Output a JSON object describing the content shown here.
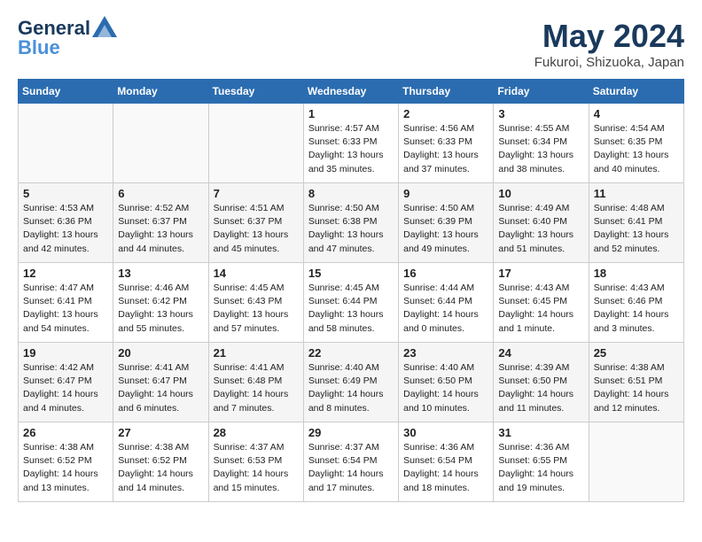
{
  "header": {
    "logo_line1": "General",
    "logo_line2": "Blue",
    "month_year": "May 2024",
    "location": "Fukuroi, Shizuoka, Japan"
  },
  "weekdays": [
    "Sunday",
    "Monday",
    "Tuesday",
    "Wednesday",
    "Thursday",
    "Friday",
    "Saturday"
  ],
  "weeks": [
    [
      {
        "day": "",
        "info": ""
      },
      {
        "day": "",
        "info": ""
      },
      {
        "day": "",
        "info": ""
      },
      {
        "day": "1",
        "info": "Sunrise: 4:57 AM\nSunset: 6:33 PM\nDaylight: 13 hours\nand 35 minutes."
      },
      {
        "day": "2",
        "info": "Sunrise: 4:56 AM\nSunset: 6:33 PM\nDaylight: 13 hours\nand 37 minutes."
      },
      {
        "day": "3",
        "info": "Sunrise: 4:55 AM\nSunset: 6:34 PM\nDaylight: 13 hours\nand 38 minutes."
      },
      {
        "day": "4",
        "info": "Sunrise: 4:54 AM\nSunset: 6:35 PM\nDaylight: 13 hours\nand 40 minutes."
      }
    ],
    [
      {
        "day": "5",
        "info": "Sunrise: 4:53 AM\nSunset: 6:36 PM\nDaylight: 13 hours\nand 42 minutes."
      },
      {
        "day": "6",
        "info": "Sunrise: 4:52 AM\nSunset: 6:37 PM\nDaylight: 13 hours\nand 44 minutes."
      },
      {
        "day": "7",
        "info": "Sunrise: 4:51 AM\nSunset: 6:37 PM\nDaylight: 13 hours\nand 45 minutes."
      },
      {
        "day": "8",
        "info": "Sunrise: 4:50 AM\nSunset: 6:38 PM\nDaylight: 13 hours\nand 47 minutes."
      },
      {
        "day": "9",
        "info": "Sunrise: 4:50 AM\nSunset: 6:39 PM\nDaylight: 13 hours\nand 49 minutes."
      },
      {
        "day": "10",
        "info": "Sunrise: 4:49 AM\nSunset: 6:40 PM\nDaylight: 13 hours\nand 51 minutes."
      },
      {
        "day": "11",
        "info": "Sunrise: 4:48 AM\nSunset: 6:41 PM\nDaylight: 13 hours\nand 52 minutes."
      }
    ],
    [
      {
        "day": "12",
        "info": "Sunrise: 4:47 AM\nSunset: 6:41 PM\nDaylight: 13 hours\nand 54 minutes."
      },
      {
        "day": "13",
        "info": "Sunrise: 4:46 AM\nSunset: 6:42 PM\nDaylight: 13 hours\nand 55 minutes."
      },
      {
        "day": "14",
        "info": "Sunrise: 4:45 AM\nSunset: 6:43 PM\nDaylight: 13 hours\nand 57 minutes."
      },
      {
        "day": "15",
        "info": "Sunrise: 4:45 AM\nSunset: 6:44 PM\nDaylight: 13 hours\nand 58 minutes."
      },
      {
        "day": "16",
        "info": "Sunrise: 4:44 AM\nSunset: 6:44 PM\nDaylight: 14 hours\nand 0 minutes."
      },
      {
        "day": "17",
        "info": "Sunrise: 4:43 AM\nSunset: 6:45 PM\nDaylight: 14 hours\nand 1 minute."
      },
      {
        "day": "18",
        "info": "Sunrise: 4:43 AM\nSunset: 6:46 PM\nDaylight: 14 hours\nand 3 minutes."
      }
    ],
    [
      {
        "day": "19",
        "info": "Sunrise: 4:42 AM\nSunset: 6:47 PM\nDaylight: 14 hours\nand 4 minutes."
      },
      {
        "day": "20",
        "info": "Sunrise: 4:41 AM\nSunset: 6:47 PM\nDaylight: 14 hours\nand 6 minutes."
      },
      {
        "day": "21",
        "info": "Sunrise: 4:41 AM\nSunset: 6:48 PM\nDaylight: 14 hours\nand 7 minutes."
      },
      {
        "day": "22",
        "info": "Sunrise: 4:40 AM\nSunset: 6:49 PM\nDaylight: 14 hours\nand 8 minutes."
      },
      {
        "day": "23",
        "info": "Sunrise: 4:40 AM\nSunset: 6:50 PM\nDaylight: 14 hours\nand 10 minutes."
      },
      {
        "day": "24",
        "info": "Sunrise: 4:39 AM\nSunset: 6:50 PM\nDaylight: 14 hours\nand 11 minutes."
      },
      {
        "day": "25",
        "info": "Sunrise: 4:38 AM\nSunset: 6:51 PM\nDaylight: 14 hours\nand 12 minutes."
      }
    ],
    [
      {
        "day": "26",
        "info": "Sunrise: 4:38 AM\nSunset: 6:52 PM\nDaylight: 14 hours\nand 13 minutes."
      },
      {
        "day": "27",
        "info": "Sunrise: 4:38 AM\nSunset: 6:52 PM\nDaylight: 14 hours\nand 14 minutes."
      },
      {
        "day": "28",
        "info": "Sunrise: 4:37 AM\nSunset: 6:53 PM\nDaylight: 14 hours\nand 15 minutes."
      },
      {
        "day": "29",
        "info": "Sunrise: 4:37 AM\nSunset: 6:54 PM\nDaylight: 14 hours\nand 17 minutes."
      },
      {
        "day": "30",
        "info": "Sunrise: 4:36 AM\nSunset: 6:54 PM\nDaylight: 14 hours\nand 18 minutes."
      },
      {
        "day": "31",
        "info": "Sunrise: 4:36 AM\nSunset: 6:55 PM\nDaylight: 14 hours\nand 19 minutes."
      },
      {
        "day": "",
        "info": ""
      }
    ]
  ]
}
